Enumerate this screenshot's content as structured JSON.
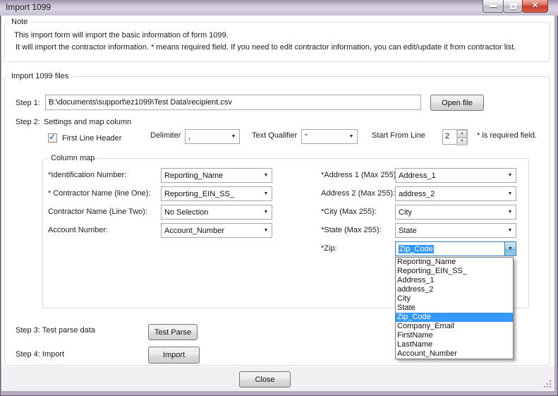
{
  "window": {
    "title": "Import 1099"
  },
  "icons": {
    "close": "✕",
    "check": "✓",
    "combo_arrow": "▼",
    "spin_up": "▲",
    "spin_down": "▼"
  },
  "note": {
    "title": "Note",
    "line1": "This import form will import the basic information of form 1099.",
    "line2": "It will import the contractor information. * means required field. If you need to edit contractor information, you can edit/update it from contractor list."
  },
  "import_files": {
    "title": "Import 1099 files",
    "step1": {
      "label": "Step 1:",
      "file_path": "B:\\documents\\support\\ez1099\\Test Data\\recipient.csv",
      "open_button": "Open file"
    },
    "step2": {
      "label": "Step 2:",
      "title": "Settings and map column",
      "first_line_header": "First Line Header",
      "first_line_header_checked": true,
      "delimiter_label": "Delimiter",
      "delimiter_value": ",",
      "text_qualifier_label": "Text Qualifier",
      "text_qualifier_value": "\"",
      "start_from_line_label": "Start From Line",
      "start_from_line_value": "2",
      "required_note": "* is required field."
    },
    "column_map": {
      "title": "Column map",
      "left": [
        {
          "label": "*Identification Number:",
          "value": "Reporting_Name"
        },
        {
          "label": "* Contractor Name (line One):",
          "value": "Reporting_EIN_SS_"
        },
        {
          "label": "Contractor Name (Line Two):",
          "value": "No Selection"
        },
        {
          "label": "Account Number:",
          "value": "Account_Number"
        }
      ],
      "right": [
        {
          "label": "*Address 1 (Max 255):",
          "value": "Address_1"
        },
        {
          "label": "Address 2 (Max 255):",
          "value": "address_2"
        },
        {
          "label": "*City (Max 255):",
          "value": "City"
        },
        {
          "label": "*State (Max 255):",
          "value": "State"
        },
        {
          "label": "*Zip:",
          "value": "Zip_Code"
        }
      ],
      "zip_dropdown": {
        "selected": "Zip_Code",
        "items": [
          "Reporting_Name",
          "Reporting_EIN_SS_",
          "Address_1",
          "address_2",
          "City",
          "State",
          "Zip_Code",
          "Company_Email",
          "FirstName",
          "LastName",
          "Account_Number"
        ]
      }
    },
    "step3": {
      "label": "Step 3: Test parse data",
      "button": "Test Parse"
    },
    "step4": {
      "label": "Step 4: Import",
      "button": "Import"
    }
  },
  "footer": {
    "close_button": "Close"
  },
  "colors": {
    "highlight": "#3399ff",
    "titlebar": "#cdc6da",
    "close_button_red": "#c93e2c"
  }
}
